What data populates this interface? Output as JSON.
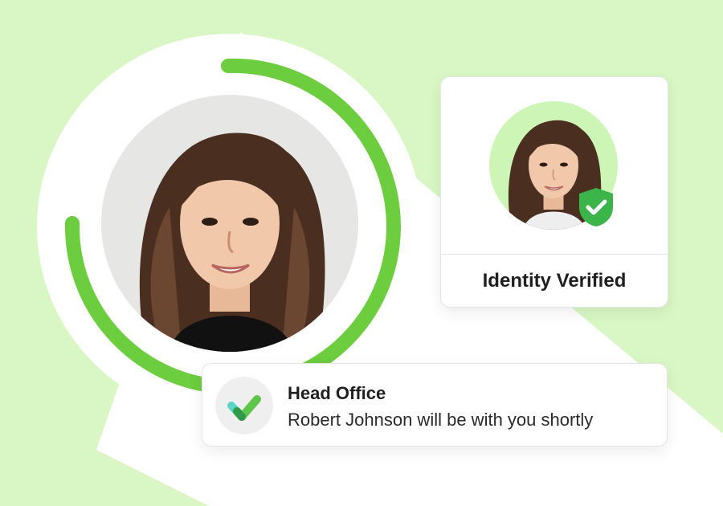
{
  "brand": {
    "accent": "#6ccd3f",
    "background": "#d9f7c4",
    "accent_light": "#cdf5b6"
  },
  "identity_card": {
    "title": "Identity Verified",
    "badge_icon": "shield-check-icon"
  },
  "message_card": {
    "logo_icon": "check-logo-icon",
    "sender": "Head Office",
    "text": "Robert Johnson will be with you shortly"
  },
  "progress_ring": {
    "icon": "progress-arc"
  }
}
